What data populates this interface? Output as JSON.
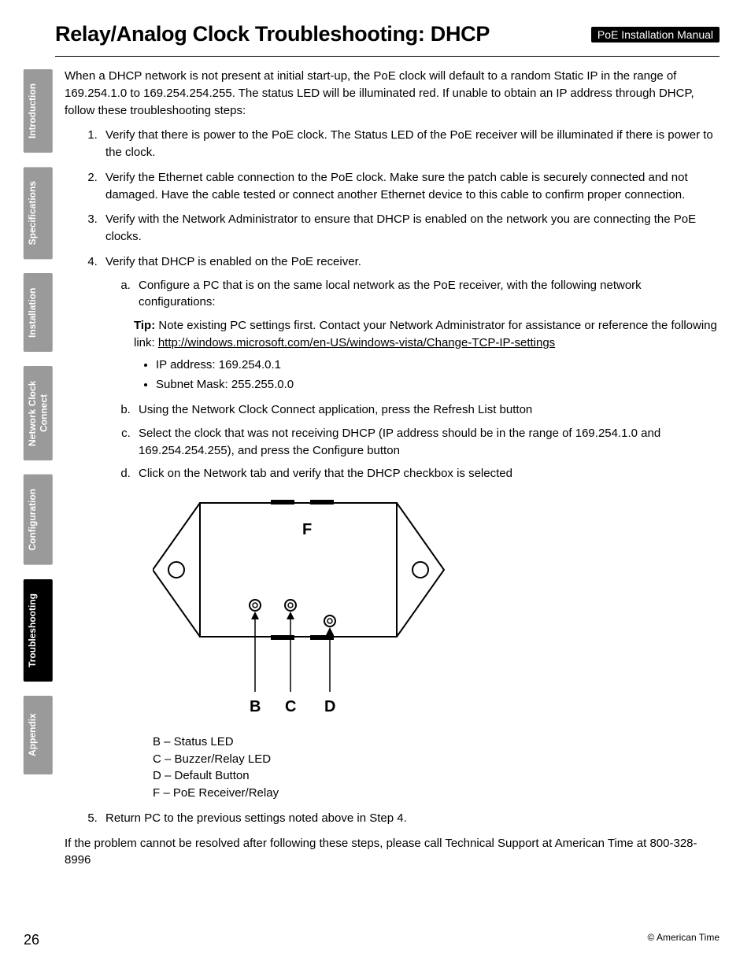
{
  "header": {
    "title": "Relay/Analog Clock Troubleshooting: DHCP",
    "badge": "PoE Installation Manual"
  },
  "tabs": [
    {
      "label": "Introduction",
      "active": false
    },
    {
      "label": "Specifications",
      "active": false
    },
    {
      "label": "Installation",
      "active": false
    },
    {
      "label": "Network Clock\nConnect",
      "active": false
    },
    {
      "label": "Configuration",
      "active": false
    },
    {
      "label": "Troubleshooting",
      "active": true
    },
    {
      "label": "Appendix",
      "active": false
    }
  ],
  "intro": "When a DHCP network is not present at initial start-up, the PoE clock will default to a random Static IP in the range of 169.254.1.0 to 169.254.254.255. The status LED will be illuminated red. If unable to obtain an IP address through DHCP, follow these troubleshooting steps:",
  "steps": {
    "s1": "Verify that there is power to the PoE clock. The Status LED of the PoE receiver will be illuminated if there is power to the clock.",
    "s2": "Verify the Ethernet cable connection to the PoE clock. Make sure the patch cable is securely connected and not damaged. Have the cable tested or connect another Ethernet device to this cable to confirm proper connection.",
    "s3": "Verify with the Network Administrator to ensure that DHCP is enabled on the network you are connecting the PoE clocks.",
    "s4": "Verify that DHCP is enabled on the PoE receiver.",
    "s4a": "Configure a PC that is on the same local network as the PoE receiver, with the following network configurations:",
    "tip_label": "Tip:",
    "tip_text": " Note existing PC settings first. Contact your Network Administrator for assistance or reference the following link: ",
    "tip_link": "http://windows.microsoft.com/en-US/windows-vista/Change-TCP-IP-settings",
    "bullet_ip": "IP address: 169.254.0.1",
    "bullet_mask": "Subnet Mask: 255.255.0.0",
    "s4b": "Using the Network Clock Connect application, press the Refresh List button",
    "s4c": "Select the clock that was not receiving DHCP (IP address should be in the range of 169.254.1.0 and 169.254.254.255), and press the Configure button",
    "s4d": "Click on the Network tab and verify that the DHCP checkbox is selected",
    "s5": "Return PC to the previous settings noted above in Step 4."
  },
  "diagram": {
    "label_F": "F",
    "label_B": "B",
    "label_C": "C",
    "label_D": "D"
  },
  "legend": {
    "b": "B – Status LED",
    "c": "C – Buzzer/Relay LED",
    "d": "D – Default Button",
    "f": "F – PoE Receiver/Relay"
  },
  "closing": "If the problem cannot be resolved after following these steps, please call Technical Support at American Time at 800-328-8996",
  "footer": {
    "page": "26",
    "copyright": "© American Time"
  }
}
